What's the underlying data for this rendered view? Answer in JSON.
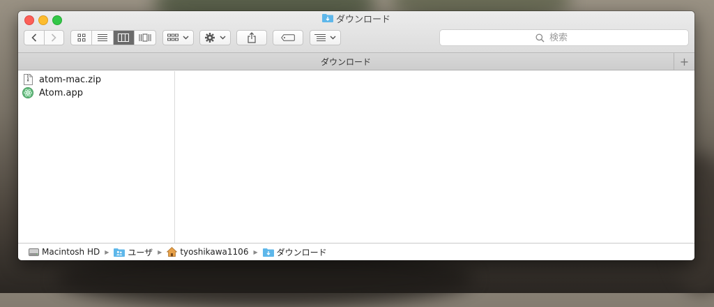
{
  "window": {
    "title": "ダウンロード"
  },
  "toolbar": {
    "search_placeholder": "検索"
  },
  "tab": {
    "label": "ダウンロード",
    "add": "+"
  },
  "files": [
    {
      "name": "atom-mac.zip",
      "icon": "zip-file-icon"
    },
    {
      "name": "Atom.app",
      "icon": "atom-app-icon"
    }
  ],
  "path": [
    {
      "label": "Macintosh HD",
      "icon": "hard-drive-icon"
    },
    {
      "label": "ユーザ",
      "icon": "users-folder-icon"
    },
    {
      "label": "tyoshikawa1106",
      "icon": "home-icon"
    },
    {
      "label": "ダウンロード",
      "icon": "downloads-folder-icon"
    }
  ]
}
